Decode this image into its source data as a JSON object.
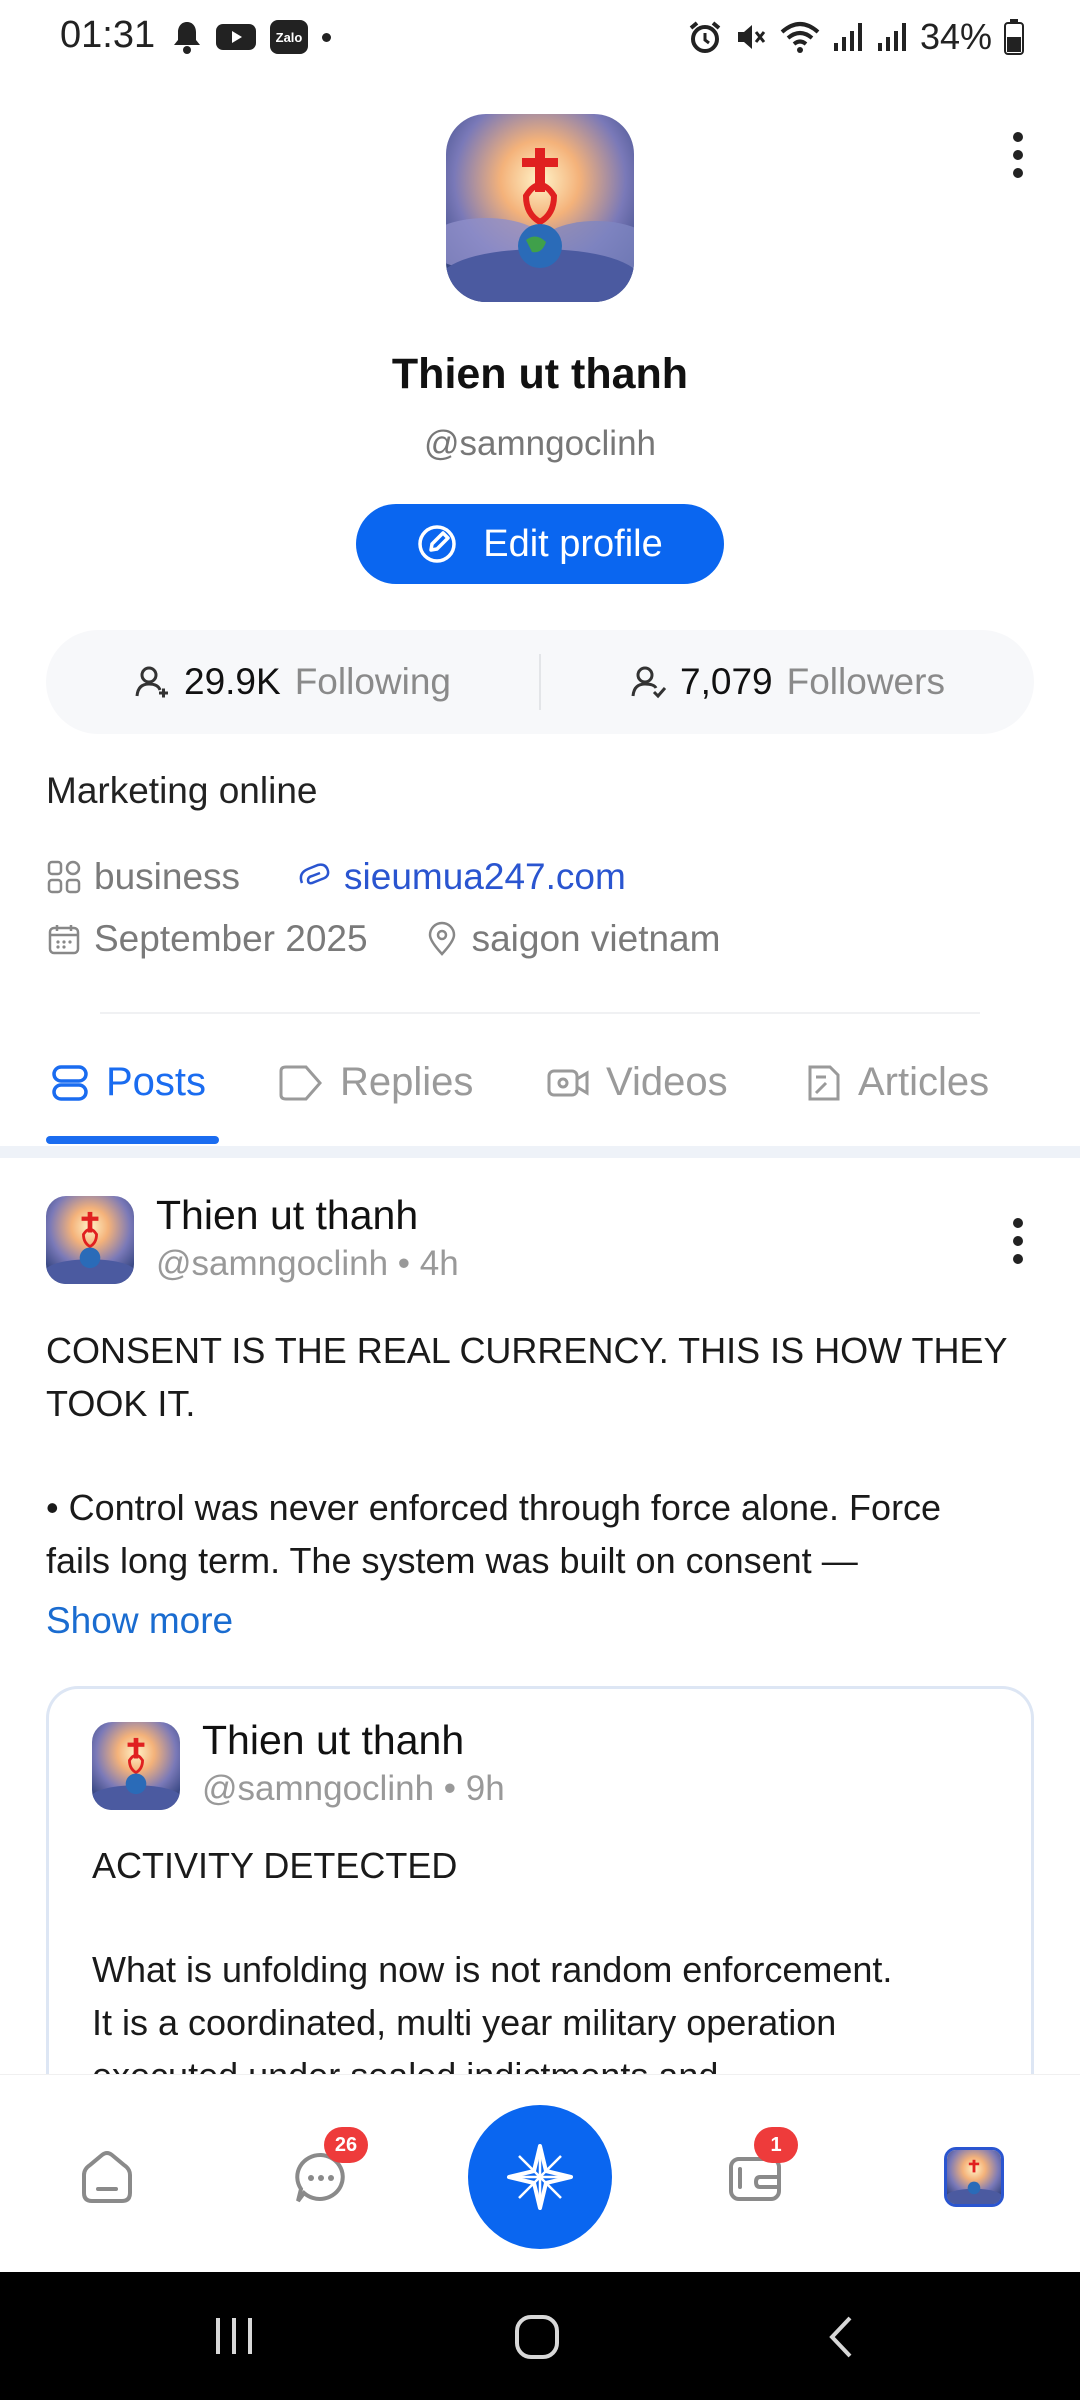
{
  "status_bar": {
    "time": "01:31",
    "battery": "34%",
    "notification_icons": [
      "bell-icon",
      "youtube-icon",
      "zalo-icon",
      "dot-icon"
    ],
    "system_icons": [
      "alarm-icon",
      "mute-icon",
      "wifi-icon",
      "signal-icon",
      "signal-icon",
      "battery-icon"
    ],
    "zalo_label": "Zalo"
  },
  "profile": {
    "name": "Thien ut thanh",
    "handle": "@samngoclinh",
    "edit_label": "Edit profile",
    "following_count": "29.9K",
    "following_label": "Following",
    "followers_count": "7,079",
    "followers_label": "Followers",
    "bio": "Marketing online",
    "category": "business",
    "website": "sieumua247.com",
    "joined": "September 2025",
    "location": "saigon vietnam"
  },
  "tabs": [
    {
      "label": "Posts",
      "icon": "posts-icon",
      "active": true
    },
    {
      "label": "Replies",
      "icon": "replies-icon",
      "active": false
    },
    {
      "label": "Videos",
      "icon": "videos-icon",
      "active": false
    },
    {
      "label": "Articles",
      "icon": "articles-icon",
      "active": false
    }
  ],
  "post": {
    "author": "Thien ut thanh",
    "meta": "@samngoclinh • 4h",
    "line1": "CONSENT IS THE REAL CURRENCY. THIS IS HOW THEY",
    "line2": "TOOK IT.",
    "line3": "• Control was never enforced through force alone. Force",
    "line4": "fails long term. The system was built on consent —",
    "show_more": "Show more"
  },
  "quoted_post": {
    "author": "Thien ut thanh",
    "meta": "@samngoclinh • 9h",
    "line1": "ACTIVITY DETECTED",
    "line2": "What is unfolding now is not random enforcement.",
    "line3": "It is a coordinated, multi year military operation",
    "line4": "executed under sealed indictments and"
  },
  "bottom_nav": {
    "items": [
      "home-icon",
      "chat-icon",
      "compose-icon",
      "wallet-icon",
      "profile-avatar"
    ],
    "chat_badge": "26",
    "wallet_badge": "1"
  },
  "colors": {
    "accent": "#0a66f0",
    "link": "#2a55d0",
    "badge": "#ee3b3b"
  }
}
